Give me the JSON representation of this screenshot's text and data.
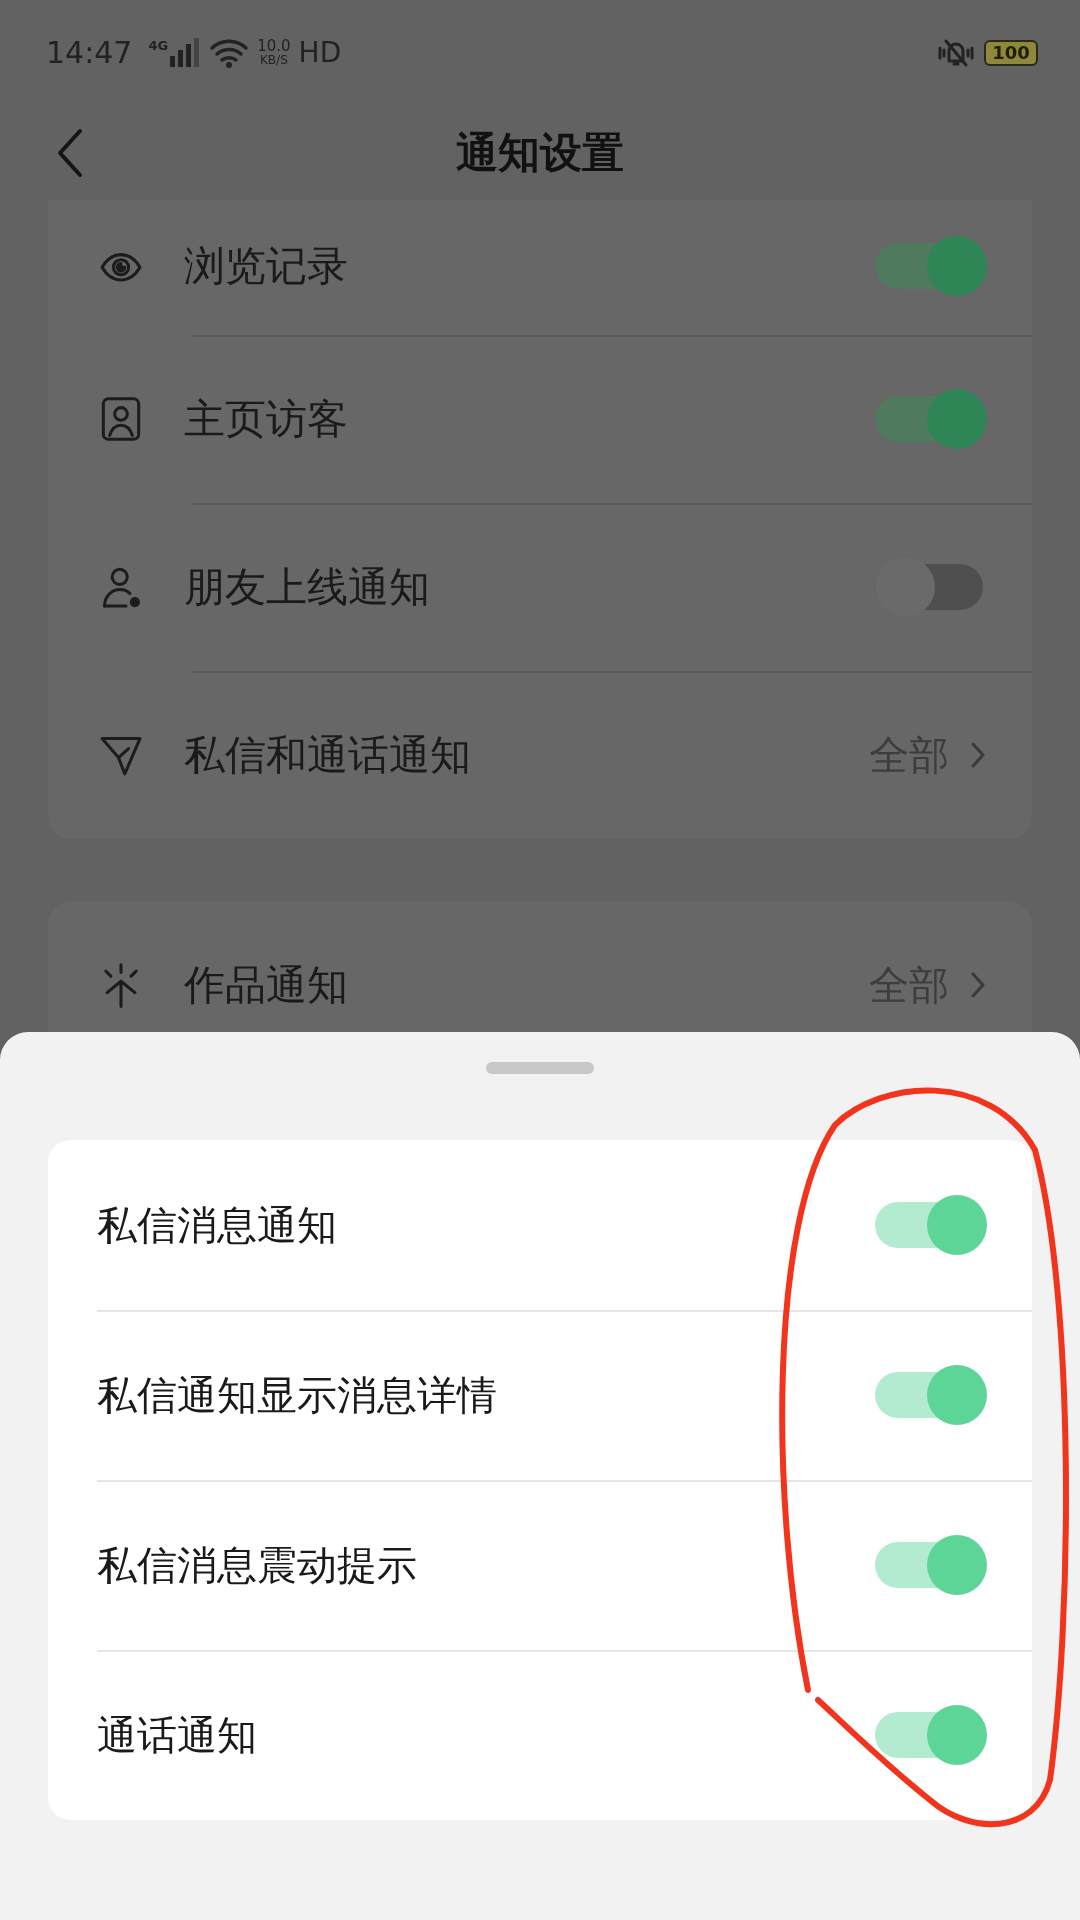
{
  "status_bar": {
    "time": "14:47",
    "network": "4G",
    "speed_value": "10.0",
    "speed_unit": "KB/S",
    "hd": "HD",
    "battery": "100"
  },
  "header": {
    "title": "通知设置"
  },
  "sections": [
    {
      "items": [
        {
          "kind": "toggle",
          "label": "浏览记录",
          "on": true
        },
        {
          "kind": "toggle",
          "label": "主页访客",
          "on": true
        },
        {
          "kind": "toggle",
          "label": "朋友上线通知",
          "on": false
        },
        {
          "kind": "link",
          "label": "私信和通话通知",
          "value": "全部"
        }
      ]
    },
    {
      "items": [
        {
          "kind": "link",
          "label": "作品通知",
          "value": "全部"
        }
      ]
    }
  ],
  "sheet": {
    "items": [
      {
        "label": "私信消息通知",
        "on": true
      },
      {
        "label": "私信通知显示消息详情",
        "on": true
      },
      {
        "label": "私信消息震动提示",
        "on": true
      },
      {
        "label": "通话通知",
        "on": true
      }
    ]
  }
}
